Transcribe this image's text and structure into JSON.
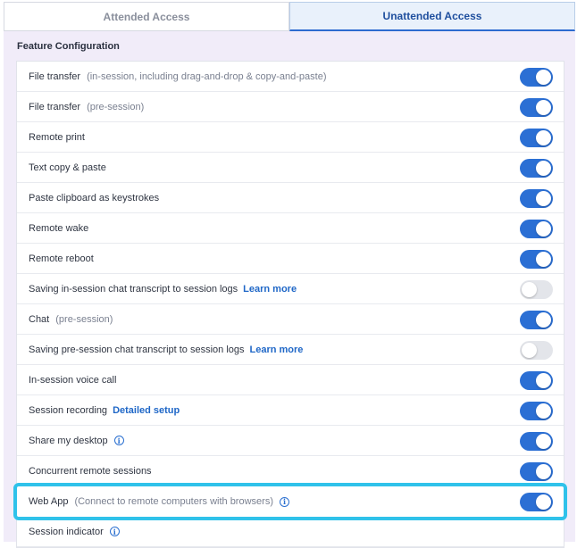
{
  "tabs": [
    {
      "label": "Attended Access",
      "active": false
    },
    {
      "label": "Unattended Access",
      "active": true
    }
  ],
  "section": {
    "title": "Feature Configuration"
  },
  "colors": {
    "accent": "#2b6fd4",
    "highlight": "#2fc2ea",
    "panel": "#f1ecf9"
  },
  "features": [
    {
      "label": "File transfer",
      "sub": "(in-session, including drag-and-drop & copy-and-paste)",
      "enabled": true
    },
    {
      "label": "File transfer",
      "sub": "(pre-session)",
      "enabled": true
    },
    {
      "label": "Remote print",
      "enabled": true
    },
    {
      "label": "Text copy & paste",
      "enabled": true
    },
    {
      "label": "Paste clipboard as keystrokes",
      "enabled": true
    },
    {
      "label": "Remote wake",
      "enabled": true
    },
    {
      "label": "Remote reboot",
      "enabled": true
    },
    {
      "label": "Saving in-session chat transcript to session logs",
      "link": "Learn more",
      "enabled": false
    },
    {
      "label": "Chat",
      "sub": "(pre-session)",
      "enabled": true
    },
    {
      "label": "Saving pre-session chat transcript to session logs",
      "link": "Learn more",
      "enabled": false
    },
    {
      "label": "In-session voice call",
      "enabled": true
    },
    {
      "label": "Session recording",
      "link": "Detailed setup",
      "enabled": true
    },
    {
      "label": "Share my desktop",
      "info": true,
      "enabled": true
    },
    {
      "label": "Concurrent remote sessions",
      "enabled": true
    },
    {
      "label": "Web App",
      "sub": "(Connect to remote computers with browsers)",
      "info": true,
      "enabled": true,
      "highlighted": true
    },
    {
      "label": "Session indicator",
      "info": true,
      "enabled": null
    }
  ],
  "icons": {
    "info": "info-circle-icon"
  }
}
